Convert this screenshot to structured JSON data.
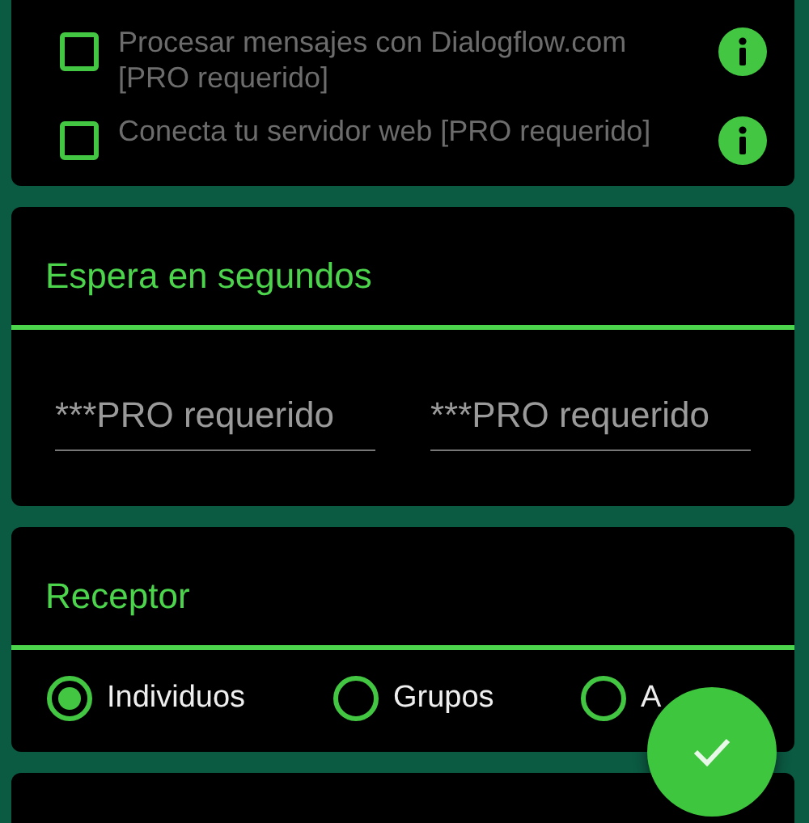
{
  "options": [
    {
      "label": "Procesar mensajes con Dialogflow.com [PRO requerido]",
      "checked": false,
      "disabled": true
    },
    {
      "label": "Conecta tu servidor web [PRO requerido]",
      "checked": false,
      "disabled": true
    }
  ],
  "wait_section": {
    "title": "Espera en segundos",
    "fields": [
      {
        "placeholder": "***PRO requerido"
      },
      {
        "placeholder": "***PRO requerido"
      }
    ]
  },
  "receiver_section": {
    "title": "Receptor",
    "choices": [
      {
        "label": "Individuos",
        "selected": true
      },
      {
        "label": "Grupos",
        "selected": false
      },
      {
        "label": "A",
        "selected": false
      }
    ]
  },
  "fab": {
    "kind": "confirm"
  }
}
